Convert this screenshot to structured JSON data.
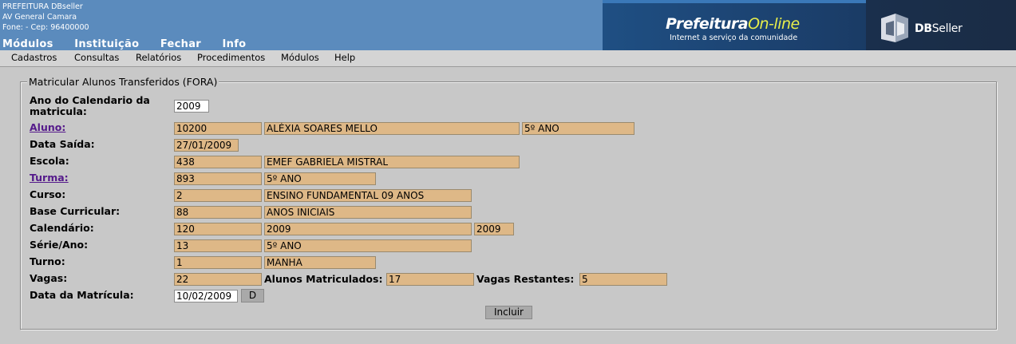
{
  "header": {
    "org_line1": "PREFEITURA DBseller",
    "org_line2": "AV General Camara",
    "org_line3": "Fone:  -  Cep: 96400000",
    "top_menu": [
      "Módulos",
      "Instituição",
      "Fechar",
      "Info"
    ],
    "logo_prefeitura_main": "Prefeitura",
    "logo_prefeitura_accent": "On-line",
    "logo_prefeitura_tagline": "Internet a serviço da comunidade",
    "logo_dbseller_bold": "DB",
    "logo_dbseller_rest": "Seller",
    "brand_blue": "#5b8bbd",
    "accent_yellow": "#e9ef4a"
  },
  "menubar": [
    "Cadastros",
    "Consultas",
    "Relatórios",
    "Procedimentos",
    "Módulos",
    "Help"
  ],
  "form": {
    "legend": "Matricular Alunos Transferidos (FORA)",
    "ano_label_1": "Ano do Calendario da",
    "ano_label_2": "matricula:",
    "ano_value": "2009",
    "aluno_label": "Aluno:",
    "aluno_code": "10200",
    "aluno_name": "ALÉXIA SOARES MELLO",
    "aluno_serie": "5º ANO",
    "data_saida_label": "Data Saída:",
    "data_saida_value": "27/01/2009",
    "escola_label": "Escola:",
    "escola_code": "438",
    "escola_name": "EMEF GABRIELA MISTRAL",
    "turma_label": "Turma:",
    "turma_code": "893",
    "turma_name": "5º ANO",
    "curso_label": "Curso:",
    "curso_code": "2",
    "curso_name": "ENSINO FUNDAMENTAL 09 ANOS",
    "base_label": "Base Curricular:",
    "base_code": "88",
    "base_name": "ANOS INICIAIS",
    "calendario_label": "Calendário:",
    "calendario_code": "120",
    "calendario_name": "2009",
    "calendario_year": "2009",
    "serie_label": "Série/Ano:",
    "serie_code": "13",
    "serie_name": "5º ANO",
    "turno_label": "Turno:",
    "turno_code": "1",
    "turno_name": "MANHA",
    "vagas_label": "Vagas:",
    "vagas_value": "22",
    "matriculados_label": "Alunos Matriculados:",
    "matriculados_value": "17",
    "restantes_label": "Vagas Restantes:",
    "restantes_value": "5",
    "data_matricula_label": "Data da Matrícula:",
    "data_matricula_value": "10/02/2009",
    "date_button": "D",
    "incluir_button": "Incluir",
    "readonly_field_color": "#deb887"
  }
}
